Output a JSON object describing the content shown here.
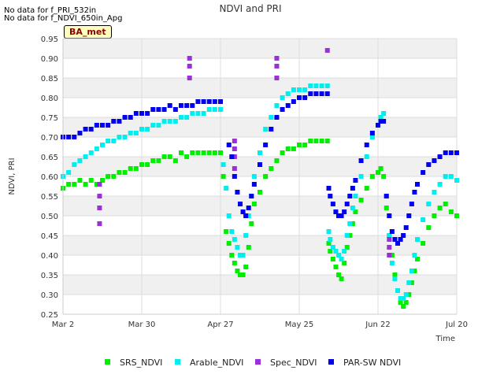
{
  "notes": [
    "No data for f_PRI_532in",
    "No data for f_NDVI_650in_Apg"
  ],
  "site_tag": "BA_met",
  "chart_data": {
    "type": "scatter",
    "title": "NDVI and PRI",
    "xlabel": "Time",
    "ylabel": "NDVI, PRI",
    "ylim": [
      0.25,
      0.95
    ],
    "yticks": [
      "0.25",
      "0.30",
      "0.35",
      "0.40",
      "0.45",
      "0.50",
      "0.55",
      "0.60",
      "0.65",
      "0.70",
      "0.75",
      "0.80",
      "0.85",
      "0.90",
      "0.95"
    ],
    "xticks": [
      "Mar 2",
      "Mar 30",
      "Apr 27",
      "May 25",
      "Jun 22",
      "Jul 20"
    ],
    "xtick_days": [
      0,
      28,
      56,
      84,
      112,
      140
    ],
    "xlim_days": [
      0,
      140
    ],
    "grid": true,
    "legend_position": "bottom",
    "series": [
      {
        "name": "SRS_NDVI",
        "color": "#00ee00",
        "x": [
          0,
          2,
          4,
          6,
          8,
          10,
          12,
          14,
          16,
          18,
          20,
          22,
          24,
          26,
          28,
          30,
          32,
          34,
          36,
          38,
          40,
          42,
          44,
          46,
          48,
          50,
          52,
          54,
          56,
          57,
          58,
          59,
          60,
          61,
          62,
          63,
          64,
          65,
          66,
          67,
          68,
          70,
          72,
          74,
          76,
          78,
          80,
          82,
          84,
          86,
          88,
          90,
          92,
          94,
          94.5,
          95,
          96,
          97,
          98,
          99,
          100,
          101,
          102,
          103,
          104,
          106,
          108,
          110,
          112,
          113,
          114,
          115,
          116,
          117,
          118,
          119,
          120,
          121,
          122,
          123,
          124,
          125,
          126,
          128,
          130,
          132,
          134,
          136,
          138,
          140
        ],
        "y": [
          0.57,
          0.58,
          0.58,
          0.59,
          0.58,
          0.59,
          0.58,
          0.59,
          0.6,
          0.6,
          0.61,
          0.61,
          0.62,
          0.62,
          0.63,
          0.63,
          0.64,
          0.64,
          0.65,
          0.65,
          0.64,
          0.66,
          0.65,
          0.66,
          0.66,
          0.66,
          0.66,
          0.66,
          0.66,
          0.6,
          0.46,
          0.43,
          0.4,
          0.38,
          0.36,
          0.35,
          0.35,
          0.37,
          0.42,
          0.48,
          0.53,
          0.56,
          0.6,
          0.62,
          0.64,
          0.66,
          0.67,
          0.67,
          0.68,
          0.68,
          0.69,
          0.69,
          0.69,
          0.69,
          0.43,
          0.41,
          0.39,
          0.37,
          0.35,
          0.34,
          0.38,
          0.42,
          0.45,
          0.48,
          0.51,
          0.54,
          0.57,
          0.6,
          0.61,
          0.62,
          0.6,
          0.52,
          0.45,
          0.4,
          0.35,
          0.31,
          0.28,
          0.27,
          0.28,
          0.3,
          0.33,
          0.36,
          0.39,
          0.43,
          0.47,
          0.5,
          0.52,
          0.53,
          0.51,
          0.5
        ]
      },
      {
        "name": "Arable_NDVI",
        "color": "#00eeee",
        "x": [
          0,
          2,
          4,
          6,
          8,
          10,
          12,
          14,
          16,
          18,
          20,
          22,
          24,
          26,
          28,
          30,
          32,
          34,
          36,
          38,
          40,
          42,
          44,
          46,
          48,
          50,
          52,
          54,
          56,
          57,
          58,
          59,
          60,
          61,
          62,
          63,
          64,
          65,
          66,
          67,
          68,
          70,
          72,
          74,
          76,
          78,
          80,
          82,
          84,
          86,
          88,
          90,
          92,
          94,
          94.5,
          95,
          96,
          97,
          98,
          99,
          100,
          101,
          102,
          103,
          104,
          106,
          108,
          110,
          112,
          113,
          114,
          115,
          116,
          117,
          118,
          119,
          120,
          121,
          122,
          123,
          124,
          125,
          126,
          128,
          130,
          132,
          134,
          136,
          138,
          140
        ],
        "y": [
          0.6,
          0.61,
          0.63,
          0.64,
          0.65,
          0.66,
          0.67,
          0.68,
          0.69,
          0.69,
          0.7,
          0.7,
          0.71,
          0.71,
          0.72,
          0.72,
          0.73,
          0.73,
          0.74,
          0.74,
          0.74,
          0.75,
          0.75,
          0.76,
          0.76,
          0.76,
          0.77,
          0.77,
          0.77,
          0.63,
          0.57,
          0.5,
          0.46,
          0.44,
          0.42,
          0.4,
          0.4,
          0.45,
          0.5,
          0.55,
          0.6,
          0.66,
          0.72,
          0.75,
          0.78,
          0.8,
          0.81,
          0.82,
          0.82,
          0.82,
          0.83,
          0.83,
          0.83,
          0.83,
          0.46,
          0.44,
          0.42,
          0.41,
          0.4,
          0.39,
          0.41,
          0.45,
          0.48,
          0.52,
          0.55,
          0.6,
          0.65,
          0.7,
          0.73,
          0.75,
          0.76,
          0.55,
          0.45,
          0.38,
          0.34,
          0.31,
          0.29,
          0.29,
          0.3,
          0.33,
          0.36,
          0.4,
          0.44,
          0.49,
          0.53,
          0.56,
          0.58,
          0.6,
          0.6,
          0.59
        ]
      },
      {
        "name": "Spec_NDVI",
        "color": "#9b30d9",
        "x": [
          13,
          13,
          13,
          13,
          45,
          45,
          45,
          61,
          61,
          61,
          61,
          76,
          76,
          76,
          94,
          116,
          116,
          116
        ],
        "y": [
          0.58,
          0.55,
          0.52,
          0.48,
          0.9,
          0.88,
          0.85,
          0.69,
          0.67,
          0.65,
          0.62,
          0.9,
          0.88,
          0.85,
          0.92,
          0.44,
          0.42,
          0.4
        ]
      },
      {
        "name": "PAR-SW NDVI",
        "color": "#0000ee",
        "x": [
          0,
          2,
          4,
          6,
          8,
          10,
          12,
          14,
          16,
          18,
          20,
          22,
          24,
          26,
          28,
          30,
          32,
          34,
          36,
          38,
          40,
          42,
          44,
          46,
          48,
          50,
          52,
          54,
          56,
          59,
          60,
          61,
          62,
          63,
          64,
          65,
          66,
          67,
          68,
          70,
          72,
          74,
          76,
          78,
          80,
          82,
          84,
          86,
          88,
          90,
          92,
          94,
          94.5,
          95,
          96,
          97,
          98,
          99,
          100,
          101,
          102,
          103,
          104,
          106,
          108,
          110,
          112,
          113,
          114,
          115,
          116,
          117,
          118,
          119,
          120,
          121,
          122,
          123,
          124,
          125,
          126,
          128,
          130,
          132,
          134,
          136,
          138,
          140
        ],
        "y": [
          0.7,
          0.7,
          0.7,
          0.71,
          0.72,
          0.72,
          0.73,
          0.73,
          0.73,
          0.74,
          0.74,
          0.75,
          0.75,
          0.76,
          0.76,
          0.76,
          0.77,
          0.77,
          0.77,
          0.78,
          0.77,
          0.78,
          0.78,
          0.78,
          0.79,
          0.79,
          0.79,
          0.79,
          0.79,
          0.68,
          0.65,
          0.6,
          0.56,
          0.53,
          0.51,
          0.5,
          0.52,
          0.55,
          0.58,
          0.63,
          0.68,
          0.72,
          0.75,
          0.77,
          0.78,
          0.79,
          0.8,
          0.8,
          0.81,
          0.81,
          0.81,
          0.81,
          0.57,
          0.55,
          0.53,
          0.51,
          0.5,
          0.5,
          0.51,
          0.53,
          0.55,
          0.57,
          0.59,
          0.64,
          0.68,
          0.71,
          0.73,
          0.74,
          0.74,
          0.55,
          0.5,
          0.46,
          0.44,
          0.43,
          0.44,
          0.45,
          0.47,
          0.5,
          0.53,
          0.56,
          0.58,
          0.61,
          0.63,
          0.64,
          0.65,
          0.66,
          0.66,
          0.66
        ]
      }
    ]
  }
}
